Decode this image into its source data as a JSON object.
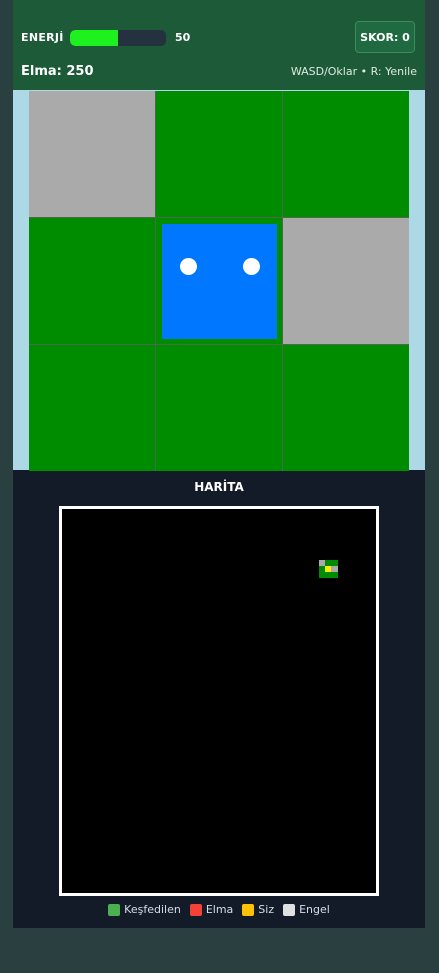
{
  "hud": {
    "energy_label": "ENERJİ",
    "energy_value": "50",
    "energy_fraction": 0.5,
    "score_label": "SKOR: 0",
    "apples_label": "Elma: 250",
    "controls_hint": "WASD/Oklar • R: Yenile"
  },
  "colors": {
    "hud_bg": "#1c5a38",
    "energy_fill": "#1ef21e",
    "grass": "#008c00",
    "rock": "#aaaaaa",
    "player": "#0077ff",
    "sky": "#add8e6"
  },
  "view": {
    "tiles": [
      "rock",
      "grass",
      "grass",
      "grass",
      "player",
      "rock",
      "grass",
      "grass",
      "grass"
    ]
  },
  "map": {
    "title": "HARİTA",
    "legend": [
      {
        "label": "Keşfedilen",
        "color": "#4caf50"
      },
      {
        "label": "Elma",
        "color": "#f44336"
      },
      {
        "label": "Siz",
        "color": "#ffc107"
      },
      {
        "label": "Engel",
        "color": "#e0e0e0"
      }
    ]
  }
}
